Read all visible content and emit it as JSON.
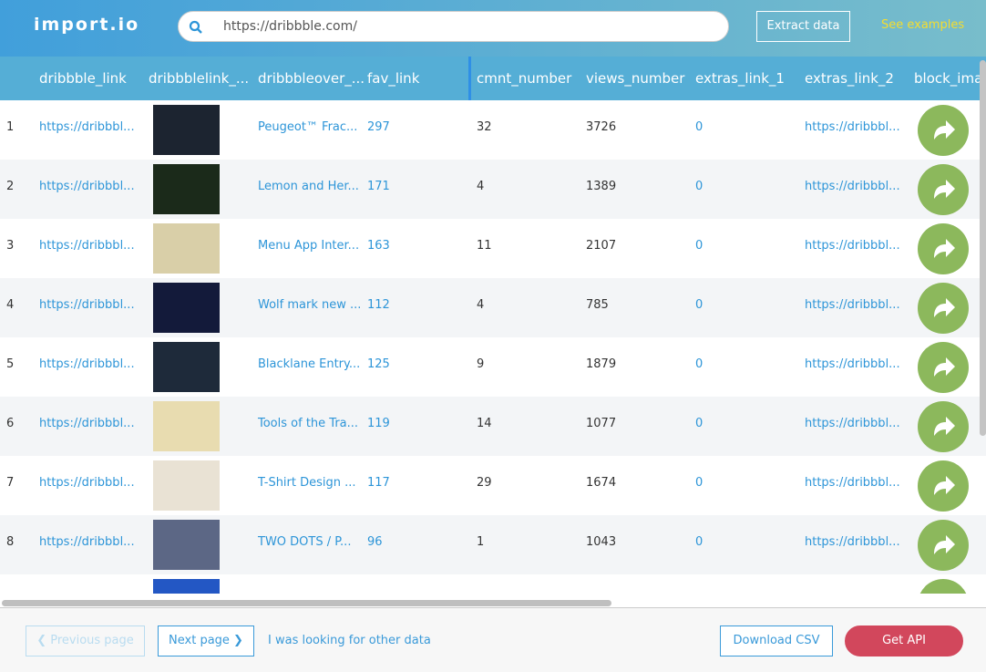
{
  "header": {
    "logo": "import.io",
    "url": "https://dribbble.com/",
    "extract_label": "Extract data",
    "examples_label": "See examples"
  },
  "columns": [
    "dribbble_link",
    "dribbblelink_...",
    "dribbbleover_...",
    "fav_link",
    "cmnt_number",
    "views_number",
    "extras_link_1",
    "extras_link_2",
    "block_ima"
  ],
  "rows": [
    {
      "n": "1",
      "link": "https://dribbbl...",
      "title": "Peugeot™ Frac...",
      "fav": "297",
      "cmnt": "32",
      "views": "3726",
      "ex1": "0",
      "ex2": "https://dribbbl..."
    },
    {
      "n": "2",
      "link": "https://dribbbl...",
      "title": "Lemon and Her...",
      "fav": "171",
      "cmnt": "4",
      "views": "1389",
      "ex1": "0",
      "ex2": "https://dribbbl..."
    },
    {
      "n": "3",
      "link": "https://dribbbl...",
      "title": "Menu App Inter...",
      "fav": "163",
      "cmnt": "11",
      "views": "2107",
      "ex1": "0",
      "ex2": "https://dribbbl..."
    },
    {
      "n": "4",
      "link": "https://dribbbl...",
      "title": "Wolf mark new ...",
      "fav": "112",
      "cmnt": "4",
      "views": "785",
      "ex1": "0",
      "ex2": "https://dribbbl..."
    },
    {
      "n": "5",
      "link": "https://dribbbl...",
      "title": "Blacklane Entry...",
      "fav": "125",
      "cmnt": "9",
      "views": "1879",
      "ex1": "0",
      "ex2": "https://dribbbl..."
    },
    {
      "n": "6",
      "link": "https://dribbbl...",
      "title": "Tools of the Tra...",
      "fav": "119",
      "cmnt": "14",
      "views": "1077",
      "ex1": "0",
      "ex2": "https://dribbbl..."
    },
    {
      "n": "7",
      "link": "https://dribbbl...",
      "title": "T-Shirt Design ...",
      "fav": "117",
      "cmnt": "29",
      "views": "1674",
      "ex1": "0",
      "ex2": "https://dribbbl..."
    },
    {
      "n": "8",
      "link": "https://dribbbl...",
      "title": "TWO DOTS / P...",
      "fav": "96",
      "cmnt": "1",
      "views": "1043",
      "ex1": "0",
      "ex2": "https://dribbbl..."
    }
  ],
  "thumb_colors": [
    "#1c2430",
    "#1b2a1a",
    "#d9cfa8",
    "#131a3a",
    "#1e2a3a",
    "#e8dcb0",
    "#e9e2d4",
    "#5c6785",
    "#2357c4"
  ],
  "footer": {
    "prev": "❮ Previous page",
    "next": "Next page ❯",
    "other": "I was looking for other data",
    "csv": "Download CSV",
    "api": "Get API"
  }
}
